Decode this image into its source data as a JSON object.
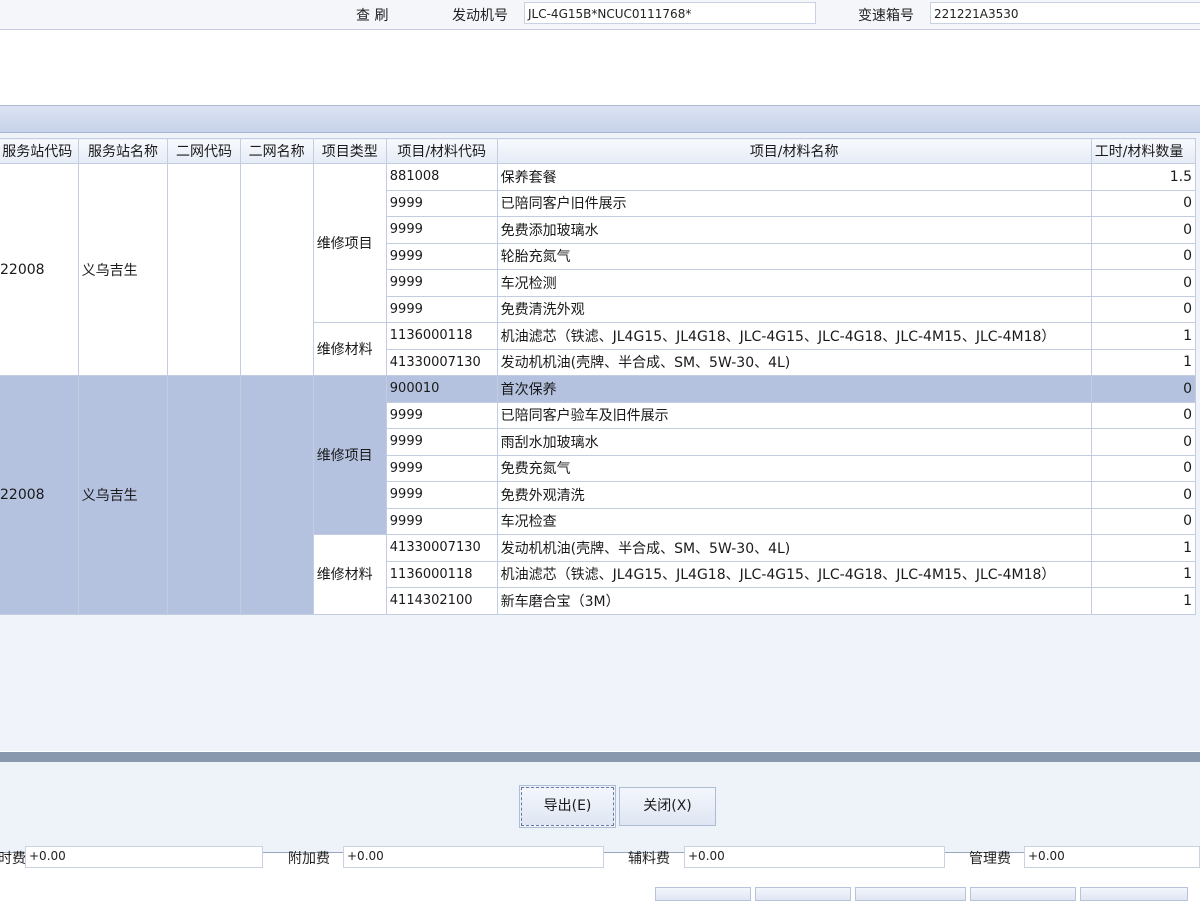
{
  "top": {
    "refresh_label": "查 刷",
    "engine_label": "发动机号",
    "engine_value": "JLC-4G15B*NCUC0111768*",
    "gearbox_label": "变速箱号",
    "gearbox_value": "221221A3530"
  },
  "grid": {
    "headers": [
      "服务站代码",
      "服务站名称",
      "二网代码",
      "二网名称",
      "项目类型",
      "项目/材料代码",
      "项目/材料名称",
      "工时/材料数量"
    ],
    "group1": {
      "station_code": "22008",
      "station_name": "义乌吉生",
      "type_repair": "维修项目",
      "type_material": "维修材料",
      "rows": [
        {
          "code": "881008",
          "name": "保养套餐",
          "qty": "1.5"
        },
        {
          "code": "9999",
          "name": "已陪同客户旧件展示",
          "qty": "0"
        },
        {
          "code": "9999",
          "name": "免费添加玻璃水",
          "qty": "0"
        },
        {
          "code": "9999",
          "name": "轮胎充氮气",
          "qty": "0"
        },
        {
          "code": "9999",
          "name": "车况检测",
          "qty": "0"
        },
        {
          "code": "9999",
          "name": "免费清洗外观",
          "qty": "0"
        },
        {
          "code": "1136000118",
          "name": "机油滤芯（铁滤、JL4G15、JL4G18、JLC-4G15、JLC-4G18、JLC-4M15、JLC-4M18）",
          "qty": "1"
        },
        {
          "code": "41330007130",
          "name": "发动机机油(壳牌、半合成、SM、5W-30、4L)",
          "qty": "1"
        }
      ]
    },
    "group2": {
      "station_code": "22008",
      "station_name": "义乌吉生",
      "type_repair": "维修项目",
      "type_material": "维修材料",
      "rows": [
        {
          "code": "900010",
          "name": "首次保养",
          "qty": "0"
        },
        {
          "code": "9999",
          "name": "已陪同客户验车及旧件展示",
          "qty": "0"
        },
        {
          "code": "9999",
          "name": "雨刮水加玻璃水",
          "qty": "0"
        },
        {
          "code": "9999",
          "name": "免费充氮气",
          "qty": "0"
        },
        {
          "code": "9999",
          "name": "免费外观清洗",
          "qty": "0"
        },
        {
          "code": "9999",
          "name": "车况检查",
          "qty": "0"
        },
        {
          "code": "41330007130",
          "name": "发动机机油(壳牌、半合成、SM、5W-30、4L)",
          "qty": "1"
        },
        {
          "code": "1136000118",
          "name": "机油滤芯（铁滤、JL4G15、JL4G18、JLC-4G15、JLC-4G18、JLC-4M15、JLC-4M18）",
          "qty": "1"
        },
        {
          "code": "4114302100",
          "name": "新车磨合宝（3M）",
          "qty": "1"
        }
      ]
    }
  },
  "buttons": {
    "export": "导出(E)",
    "close": "关闭(X)"
  },
  "fees": {
    "f1_label": "时费",
    "f1_value": "+0.00",
    "f2_label": "附加费",
    "f2_value": "+0.00",
    "f3_label": "辅料费",
    "f3_value": "+0.00",
    "f4_label": "管理费",
    "f4_value": "+0.00"
  }
}
